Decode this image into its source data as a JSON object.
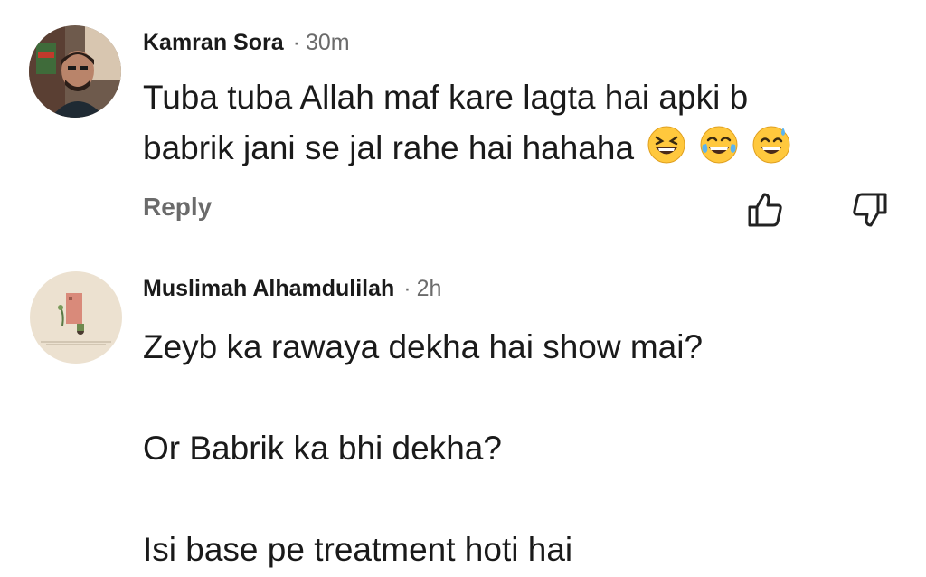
{
  "comments": [
    {
      "author": "Kamran Sora",
      "separator": "·",
      "time": "30m",
      "text": "Tuba tuba Allah maf kare lagta hai apki b\nbabrik jani se jal rahe hai hahaha",
      "emojis": [
        "laughing-emoji",
        "tears-of-joy-emoji",
        "grinning-sweat-emoji"
      ],
      "reply_label": "Reply",
      "avatar": "profile-photo"
    },
    {
      "author": "Muslimah Alhamdulilah",
      "separator": "·",
      "time": "2h",
      "text": "Zeyb ka rawaya dekha hai show mai?\n\nOr Babrik ka bhi dekha?\n\nIsi base pe treatment hoti hai",
      "avatar": "illustration-avatar"
    }
  ],
  "colors": {
    "text": "#1a1a1a",
    "muted": "#6b6b6b",
    "emoji_yellow": "#ffc83d"
  }
}
